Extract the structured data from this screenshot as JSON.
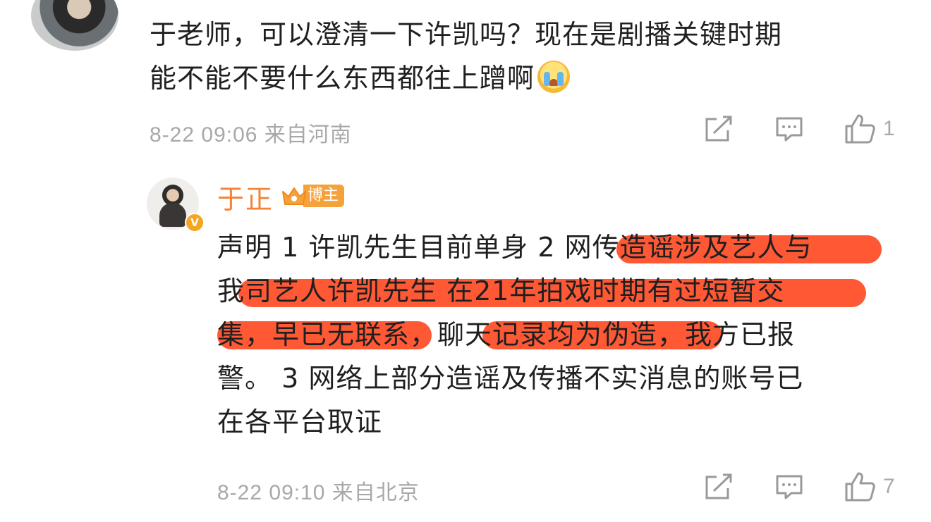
{
  "comment1": {
    "text_line1": "于老师，可以澄清一下许凯吗？现在是剧播关键时期",
    "text_line2": "能不能不要什么东西都往上蹭啊",
    "emoji": "crying-emoji",
    "meta": "8-22 09:06  来自河南",
    "like_count": "1"
  },
  "reply": {
    "author": "于正",
    "badge_label": "博主",
    "verified_mark": "V",
    "lines": [
      "声明 1 许凯先生目前单身 2 网传造谣涉及艺人与",
      "我司艺人许凯先生 在21年拍戏时期有过短暂交",
      "集，早已无联系，聊天记录均为伪造，我方已报",
      "警。 3 网络上部分造谣及传播不实消息的账号已",
      "在各平台取证"
    ],
    "meta": "8-22 09:10  来自北京",
    "like_count": "7"
  },
  "colors": {
    "author_name": "#f48135",
    "highlight": "#ff4a24",
    "meta_text": "#a8a8a8",
    "badge": "#f6a23c"
  },
  "icons": [
    "share-icon",
    "comment-icon",
    "like-icon"
  ]
}
